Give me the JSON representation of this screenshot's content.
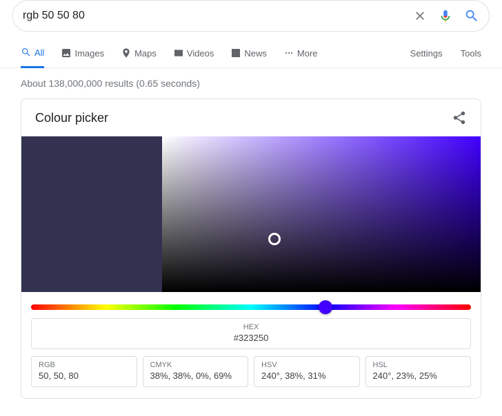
{
  "search": {
    "query": "rgb 50 50 80"
  },
  "tabs": {
    "all": "All",
    "images": "Images",
    "maps": "Maps",
    "videos": "Videos",
    "news": "News",
    "more": "More",
    "settings": "Settings",
    "tools": "Tools"
  },
  "result_stats": "About 138,000,000 results (0.65 seconds)",
  "card": {
    "title": "Colour picker",
    "swatch_color": "#323250",
    "hue_hex": "#4100ff",
    "thumb_color": "#4100ff",
    "hex": {
      "label": "HEX",
      "value": "#323250"
    },
    "rgb": {
      "label": "RGB",
      "value": "50, 50, 80"
    },
    "cmyk": {
      "label": "CMYK",
      "value": "38%, 38%, 0%, 69%"
    },
    "hsv": {
      "label": "HSV",
      "value": "240°, 38%, 31%"
    },
    "hsl": {
      "label": "HSL",
      "value": "240°, 23%, 25%"
    }
  }
}
